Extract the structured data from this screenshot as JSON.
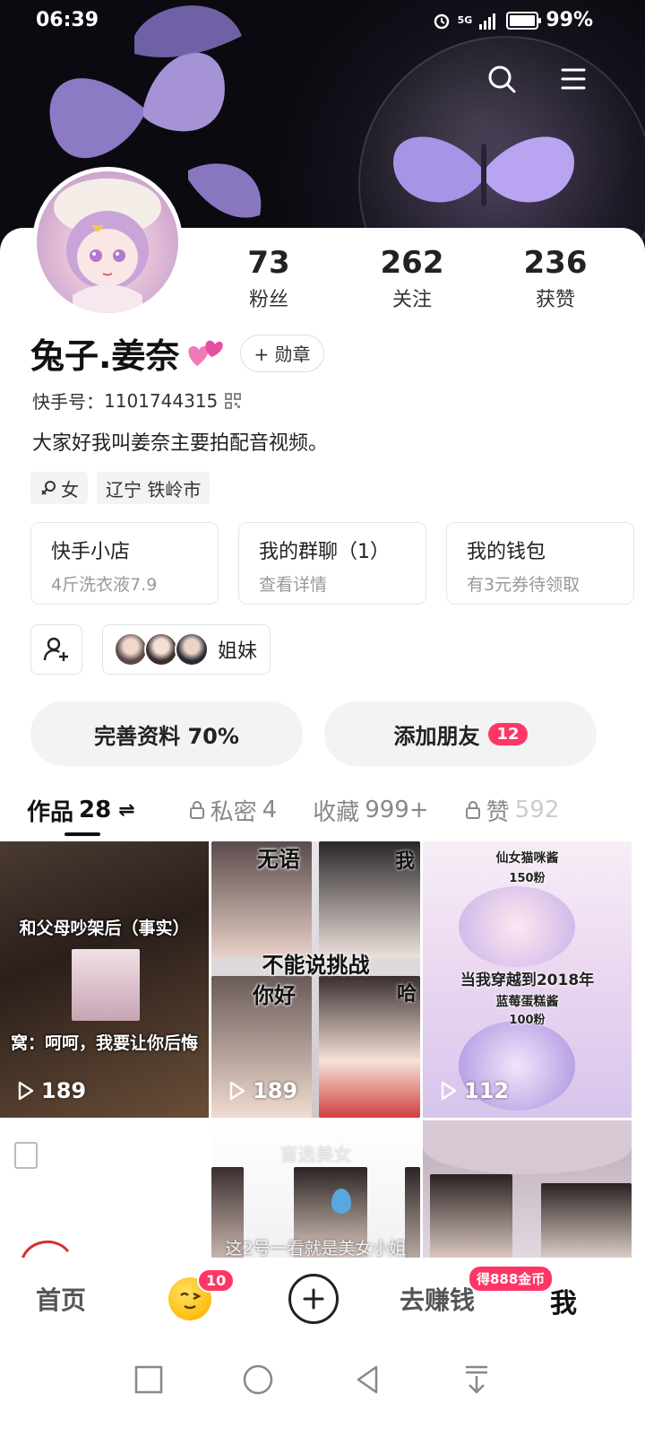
{
  "status_bar": {
    "time": "06:39",
    "network": "5G",
    "battery": "99%"
  },
  "profile": {
    "name": "兔子.姜奈",
    "medal_label": "+ 勋章",
    "kuaishou_id_label": "快手号：",
    "kuaishou_id": "1101744315",
    "bio": "大家好我叫姜奈主要拍配音视频。",
    "gender_tag": "女",
    "location_tag": "辽宁 铁岭市"
  },
  "stats": [
    {
      "value": "73",
      "label": "粉丝"
    },
    {
      "value": "262",
      "label": "关注"
    },
    {
      "value": "236",
      "label": "获赞"
    }
  ],
  "services": [
    {
      "title": "快手小店",
      "sub": "4斤洗衣液7.9"
    },
    {
      "title": "我的群聊（1）",
      "sub": "查看详情"
    },
    {
      "title": "我的钱包",
      "sub": "有3元券待领取"
    }
  ],
  "group": {
    "label": "姐妹"
  },
  "actions": {
    "complete_profile": "完善资料 70%",
    "add_friends": "添加朋友",
    "add_friends_badge": "12"
  },
  "tabs": [
    {
      "label": "作品",
      "count": "28"
    },
    {
      "label": "私密",
      "count": "4"
    },
    {
      "label": "收藏",
      "count": "999+"
    },
    {
      "label": "赞",
      "count": "592"
    }
  ],
  "grid": [
    {
      "caption1": "和父母吵架后（事实）",
      "caption2": "窝：呵呵，我要让你后悔",
      "plays": "189"
    },
    {
      "caption1": "无语",
      "caption1b": "我",
      "caption2": "不能说挑战",
      "caption3": "你好",
      "caption3b": "哈",
      "plays": "189"
    },
    {
      "caption1": "仙女猫咪酱",
      "caption1b": "150粉",
      "caption2": "当我穿越到2018年",
      "caption3": "蓝莓蛋糕酱",
      "caption3b": "100粉",
      "plays": "112"
    },
    {
      "caption1": ""
    },
    {
      "caption1": "盲选美女",
      "caption2": "这2号一看就是美女小姐"
    },
    {
      "caption1": ""
    }
  ],
  "bottom_nav": {
    "home": "首页",
    "emoji_badge": "10",
    "earn": "去赚钱",
    "earn_badge": "得888金币",
    "me": "我"
  }
}
